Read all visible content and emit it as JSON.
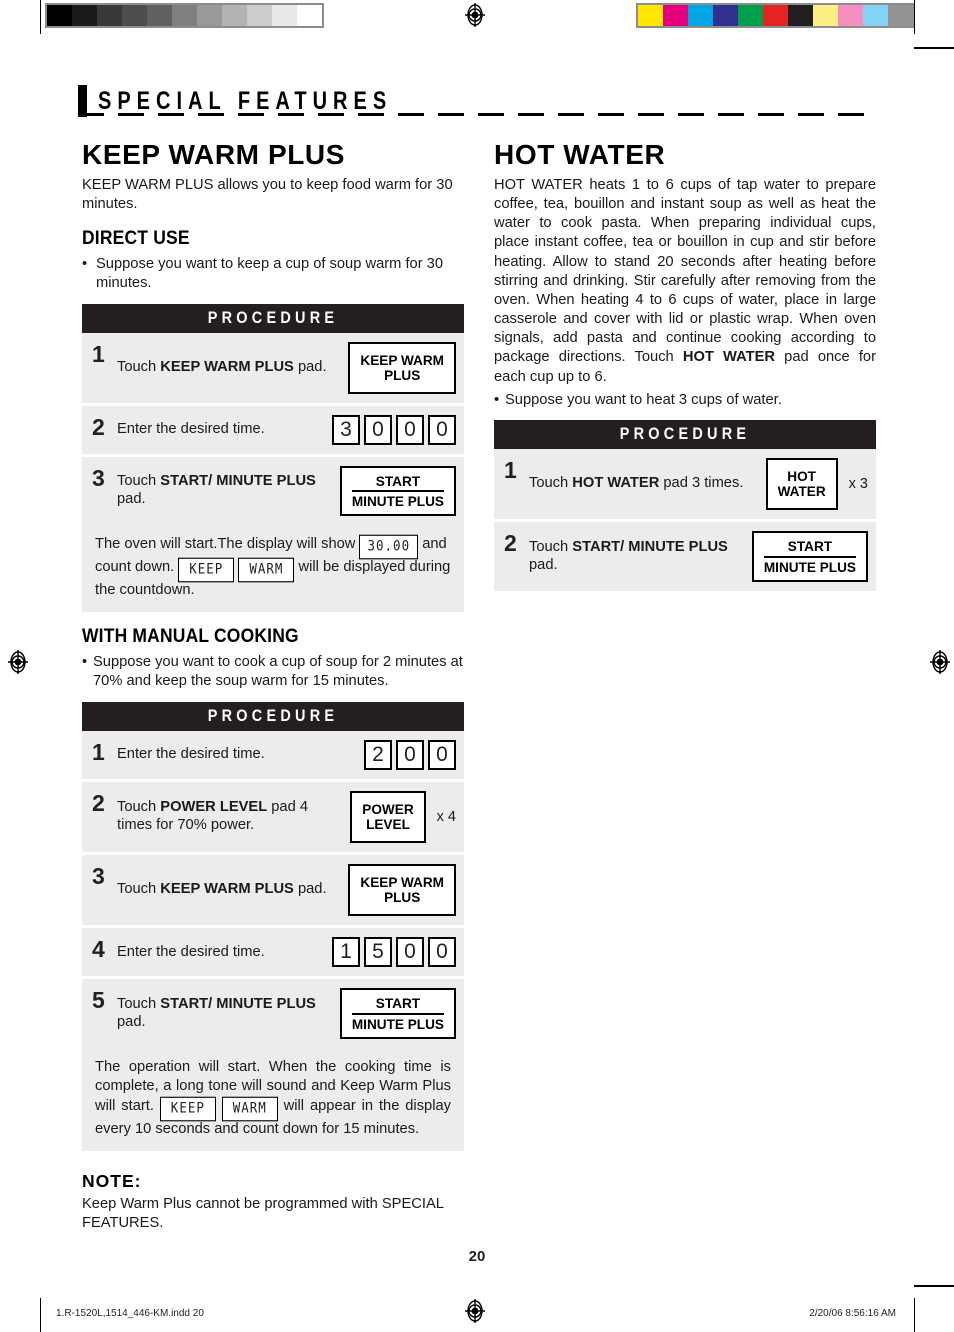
{
  "running_head": {
    "title": "SPECIAL FEATURES"
  },
  "calibration": {
    "gray_ramp": [
      "#000000",
      "#1c1a1a",
      "#3a3737",
      "#4f4c4c",
      "#616060",
      "#807f7f",
      "#9a9999",
      "#b3b3b3",
      "#cccccc",
      "#e9e9e9",
      "#ffffff"
    ],
    "color_bar": [
      "#ffe600",
      "#e6007e",
      "#00a5e3",
      "#303090",
      "#00a04a",
      "#e52421",
      "#231f20",
      "#fdee85",
      "#f48fc0",
      "#82d3f4",
      "#949494"
    ],
    "registration_icon": "registration-target-icon"
  },
  "left_column": {
    "heading": "KEEP WARM PLUS",
    "intro": "KEEP WARM PLUS allows you to keep food warm for 30 minutes.",
    "direct_use": {
      "heading": "DIRECT USE",
      "bullet": "Suppose you want to keep a cup of soup warm for 30 minutes.",
      "procedure": {
        "header": "PROCEDURE",
        "steps": [
          {
            "number": "1",
            "text_prefix": "Touch ",
            "text_bold": "KEEP WARM PLUS",
            "text_suffix": " pad.",
            "art_type": "pad",
            "pad_line1": "KEEP WARM",
            "pad_line2": "PLUS",
            "multiplier": ""
          },
          {
            "number": "2",
            "text_prefix": "Enter the desired time.",
            "text_bold": "",
            "text_suffix": "",
            "art_type": "digits",
            "digits": [
              "3",
              "0",
              "0",
              "0"
            ],
            "multiplier": ""
          },
          {
            "number": "3",
            "text_prefix": "Touch ",
            "text_bold": "START/ MINUTE PLUS",
            "text_suffix": " pad.",
            "art_type": "pad-start",
            "pad_line1": "START",
            "pad_line2": "MINUTE PLUS",
            "multiplier": ""
          }
        ],
        "note_part1": "The oven will start.The display will show ",
        "note_lcd1": "30.00",
        "note_part2": " and count down. ",
        "note_lcd2": "KEEP",
        "note_lcd3": "WARM",
        "note_part3": " will be displayed during the countdown."
      }
    },
    "manual_cooking": {
      "heading": "WITH MANUAL COOKING",
      "bullet": "Suppose you want to cook a cup of soup for 2 minutes at 70% and keep the soup warm for 15 minutes.",
      "procedure": {
        "header": "PROCEDURE",
        "steps": [
          {
            "number": "1",
            "text_prefix": "Enter the desired time.",
            "text_bold": "",
            "text_suffix": "",
            "art_type": "digits",
            "digits": [
              "2",
              "0",
              "0"
            ],
            "multiplier": ""
          },
          {
            "number": "2",
            "text_prefix": "Touch ",
            "text_bold": "POWER LEVEL",
            "text_suffix": " pad 4 times for 70% power.",
            "art_type": "pad",
            "pad_line1": "POWER",
            "pad_line2": "LEVEL",
            "multiplier": "x 4"
          },
          {
            "number": "3",
            "text_prefix": "Touch ",
            "text_bold": "KEEP WARM PLUS",
            "text_suffix": " pad.",
            "art_type": "pad",
            "pad_line1": "KEEP WARM",
            "pad_line2": "PLUS",
            "multiplier": ""
          },
          {
            "number": "4",
            "text_prefix": "Enter the desired time.",
            "text_bold": "",
            "text_suffix": "",
            "art_type": "digits",
            "digits": [
              "1",
              "5",
              "0",
              "0"
            ],
            "multiplier": ""
          },
          {
            "number": "5",
            "text_prefix": "Touch ",
            "text_bold": "START/ MINUTE PLUS",
            "text_suffix": " pad.",
            "art_type": "pad-start",
            "pad_line1": "START",
            "pad_line2": "MINUTE PLUS",
            "multiplier": ""
          }
        ],
        "note_part1": "The operation will start. When the cooking time is complete, a long tone will sound and Keep Warm Plus will start. ",
        "note_lcd1": "KEEP",
        "note_lcd2": "WARM",
        "note_part2": " will appear in the display every 10 seconds and count down for 15 minutes."
      }
    },
    "note": {
      "heading": "NOTE:",
      "text": "Keep Warm Plus cannot be programmed with SPECIAL FEATURES."
    }
  },
  "right_column": {
    "heading": "HOT WATER",
    "intro_part1": "HOT WATER heats 1 to 6 cups of tap water to prepare coffee, tea, bouillon and instant soup as well as heat the water to cook pasta. When preparing individual cups, place instant coffee, tea or bouillon in cup and stir before heating. Allow to stand 20 seconds after heating before stirring and drinking. Stir carefully after removing from the oven. When heating 4 to 6 cups of water, place in large casserole and cover with lid or plastic wrap. When oven signals, add pasta and continue cooking according to package directions. Touch ",
    "intro_bold": "HOT WATER",
    "intro_part2": " pad once for each cup up to 6.",
    "bullet": "Suppose you want to heat 3 cups of water.",
    "procedure": {
      "header": "PROCEDURE",
      "steps": [
        {
          "number": "1",
          "text_prefix": "Touch ",
          "text_bold": "HOT WATER",
          "text_suffix": " pad 3 times.",
          "art_type": "pad",
          "pad_line1": "HOT",
          "pad_line2": "WATER",
          "multiplier": "x 3"
        },
        {
          "number": "2",
          "text_prefix": "Touch ",
          "text_bold": "START/ MINUTE PLUS",
          "text_suffix": " pad.",
          "art_type": "pad-start",
          "pad_line1": "START",
          "pad_line2": "MINUTE PLUS",
          "multiplier": ""
        }
      ]
    }
  },
  "footer": {
    "page_number": "20",
    "file_info": "1.R-1520L,1514_446-KM.indd   20",
    "timestamp": "2/20/06   8:56:16 AM"
  }
}
